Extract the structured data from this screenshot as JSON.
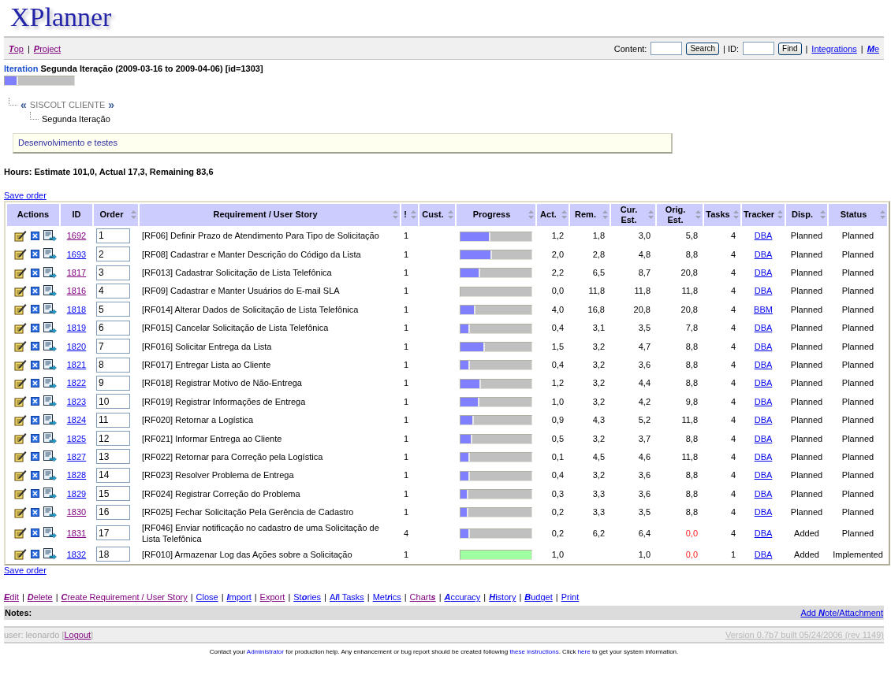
{
  "logo": "XPlanner",
  "nav": {
    "separator": "|",
    "links": [
      {
        "label": "**T**op",
        "visited": true
      },
      {
        "label": "**P**roject",
        "visited": true
      }
    ],
    "content_label": "Content:",
    "search_button": "Search",
    "id_label": "| ID:",
    "find_button": "Find",
    "right_links": [
      {
        "label": "Integrations",
        "visited": false
      },
      {
        "label": "**M**e",
        "visited": false
      }
    ]
  },
  "iteration": {
    "label": "Iteration",
    "title": "Segunda Iteração (2009-03-16 to 2009-04-06) [id=1303]",
    "level": 0.17
  },
  "breadcrumb": {
    "prev": "«",
    "project": "SISCOLT CLIENTE",
    "next": "»",
    "iteration": "Segunda Iteração"
  },
  "description": "Desenvolvimento e testes",
  "hours": "Hours: Estimate 101,0, Actual 17,3, Remaining 83,6",
  "save_order_top": "Save order",
  "table": {
    "columns": [
      {
        "label": "Actions",
        "sortable": false
      },
      {
        "label": "ID",
        "sortable": false
      },
      {
        "label": "Order",
        "sortable": true
      },
      {
        "label": "Requirement / User Story",
        "sortable": true
      },
      {
        "label": "!",
        "sortable": true
      },
      {
        "label": "Cust.",
        "sortable": true
      },
      {
        "label": "Progress",
        "sortable": true
      },
      {
        "label": "Act.",
        "sortable": true
      },
      {
        "label": "Rem.",
        "sortable": true
      },
      {
        "label": "Cur. Est.",
        "sortable": true
      },
      {
        "label": "Orig. Est.",
        "sortable": true
      },
      {
        "label": "Tasks",
        "sortable": true
      },
      {
        "label": "Tracker",
        "sortable": true
      },
      {
        "label": "Disp.",
        "sortable": true
      },
      {
        "label": "Status",
        "sortable": true
      }
    ],
    "rows": [
      {
        "id": "1692",
        "visited": true,
        "order": "1",
        "story": "[RF06] Definir Prazo de Atendimento Para Tipo de Solicitação",
        "priority": "1",
        "level": 0.4,
        "complete": false,
        "act": "1,2",
        "rem": "1,8",
        "cur": "3,0",
        "orig": "5,8",
        "orig_alert": false,
        "tasks": "4",
        "tracker": "DBA",
        "disp": "Planned",
        "status": "Planned"
      },
      {
        "id": "1693",
        "visited": false,
        "order": "2",
        "story": "[RF08] Cadastrar e Manter Descrição do Código da Lista",
        "priority": "1",
        "level": 0.42,
        "complete": false,
        "act": "2,0",
        "rem": "2,8",
        "cur": "4,8",
        "orig": "8,8",
        "orig_alert": false,
        "tasks": "4",
        "tracker": "DBA",
        "disp": "Planned",
        "status": "Planned"
      },
      {
        "id": "1817",
        "visited": true,
        "order": "3",
        "story": "[RF013] Cadastrar Solicitação de Lista Telefônica",
        "priority": "1",
        "level": 0.25,
        "complete": false,
        "act": "2,2",
        "rem": "6,5",
        "cur": "8,7",
        "orig": "20,8",
        "orig_alert": false,
        "tasks": "4",
        "tracker": "DBA",
        "disp": "Planned",
        "status": "Planned"
      },
      {
        "id": "1816",
        "visited": true,
        "order": "4",
        "story": "[RF09] Cadastrar e Manter Usuários do E-mail SLA",
        "priority": "1",
        "level": 0,
        "complete": false,
        "act": "0,0",
        "rem": "11,8",
        "cur": "11,8",
        "orig": "11,8",
        "orig_alert": false,
        "tasks": "4",
        "tracker": "DBA",
        "disp": "Planned",
        "status": "Planned"
      },
      {
        "id": "1818",
        "visited": false,
        "order": "5",
        "story": "[RF014] Alterar Dados de Solicitação de Lista Telefônica",
        "priority": "1",
        "level": 0.19,
        "complete": false,
        "act": "4,0",
        "rem": "16,8",
        "cur": "20,8",
        "orig": "20,8",
        "orig_alert": false,
        "tasks": "4",
        "tracker": "BBM",
        "disp": "Planned",
        "status": "Planned"
      },
      {
        "id": "1819",
        "visited": false,
        "order": "6",
        "story": "[RF015] Cancelar Solicitação de Lista Telefônica",
        "priority": "1",
        "level": 0.11,
        "complete": false,
        "act": "0,4",
        "rem": "3,1",
        "cur": "3,5",
        "orig": "7,8",
        "orig_alert": false,
        "tasks": "4",
        "tracker": "DBA",
        "disp": "Planned",
        "status": "Planned"
      },
      {
        "id": "1820",
        "visited": false,
        "order": "7",
        "story": "[RF016] Solicitar Entrega da Lista",
        "priority": "1",
        "level": 0.32,
        "complete": false,
        "act": "1,5",
        "rem": "3,2",
        "cur": "4,7",
        "orig": "8,8",
        "orig_alert": false,
        "tasks": "4",
        "tracker": "DBA",
        "disp": "Planned",
        "status": "Planned"
      },
      {
        "id": "1821",
        "visited": false,
        "order": "8",
        "story": "[RF017] Entregar Lista ao Cliente",
        "priority": "1",
        "level": 0.11,
        "complete": false,
        "act": "0,4",
        "rem": "3,2",
        "cur": "3,6",
        "orig": "8,8",
        "orig_alert": false,
        "tasks": "4",
        "tracker": "DBA",
        "disp": "Planned",
        "status": "Planned"
      },
      {
        "id": "1822",
        "visited": false,
        "order": "9",
        "story": "[RF018] Registrar Motivo de Não-Entrega",
        "priority": "1",
        "level": 0.27,
        "complete": false,
        "act": "1,2",
        "rem": "3,2",
        "cur": "4,4",
        "orig": "8,8",
        "orig_alert": false,
        "tasks": "4",
        "tracker": "DBA",
        "disp": "Planned",
        "status": "Planned"
      },
      {
        "id": "1823",
        "visited": false,
        "order": "10",
        "story": "[RF019] Registrar Informações de Entrega",
        "priority": "1",
        "level": 0.24,
        "complete": false,
        "act": "1,0",
        "rem": "3,2",
        "cur": "4,2",
        "orig": "9,8",
        "orig_alert": false,
        "tasks": "4",
        "tracker": "DBA",
        "disp": "Planned",
        "status": "Planned"
      },
      {
        "id": "1824",
        "visited": false,
        "order": "11",
        "story": "[RF020] Retornar a Logística",
        "priority": "1",
        "level": 0.17,
        "complete": false,
        "act": "0,9",
        "rem": "4,3",
        "cur": "5,2",
        "orig": "11,8",
        "orig_alert": false,
        "tasks": "4",
        "tracker": "DBA",
        "disp": "Planned",
        "status": "Planned"
      },
      {
        "id": "1825",
        "visited": false,
        "order": "12",
        "story": "[RF021] Informar Entrega ao Cliente",
        "priority": "1",
        "level": 0.14,
        "complete": false,
        "act": "0,5",
        "rem": "3,2",
        "cur": "3,7",
        "orig": "8,8",
        "orig_alert": false,
        "tasks": "4",
        "tracker": "DBA",
        "disp": "Planned",
        "status": "Planned"
      },
      {
        "id": "1827",
        "visited": false,
        "order": "13",
        "story": "[RF022] Retornar para Correção pela Logística",
        "priority": "1",
        "level": 0.11,
        "complete": false,
        "act": "0,1",
        "rem": "4,5",
        "cur": "4,6",
        "orig": "11,8",
        "orig_alert": false,
        "tasks": "4",
        "tracker": "DBA",
        "disp": "Planned",
        "status": "Planned"
      },
      {
        "id": "1828",
        "visited": false,
        "order": "14",
        "story": "[RF023] Resolver Problema de Entrega",
        "priority": "1",
        "level": 0.11,
        "complete": false,
        "act": "0,4",
        "rem": "3,2",
        "cur": "3,6",
        "orig": "8,8",
        "orig_alert": false,
        "tasks": "4",
        "tracker": "DBA",
        "disp": "Planned",
        "status": "Planned"
      },
      {
        "id": "1829",
        "visited": false,
        "order": "15",
        "story": "[RF024] Registrar Correção do Problema",
        "priority": "1",
        "level": 0.09,
        "complete": false,
        "act": "0,3",
        "rem": "3,3",
        "cur": "3,6",
        "orig": "8,8",
        "orig_alert": false,
        "tasks": "4",
        "tracker": "DBA",
        "disp": "Planned",
        "status": "Planned"
      },
      {
        "id": "1830",
        "visited": true,
        "order": "16",
        "story": "[RF025] Fechar Solicitação Pela Gerência de Cadastro",
        "priority": "1",
        "level": 0.09,
        "complete": false,
        "act": "0,2",
        "rem": "3,3",
        "cur": "3,5",
        "orig": "8,8",
        "orig_alert": false,
        "tasks": "4",
        "tracker": "DBA",
        "disp": "Planned",
        "status": "Planned"
      },
      {
        "id": "1831",
        "visited": true,
        "order": "17",
        "story": "[RF046] Enviar notificação no cadastro de uma Solicitação de Lista Telefônica",
        "priority": "4",
        "level": 0.11,
        "complete": false,
        "act": "0,2",
        "rem": "6,2",
        "cur": "6,4",
        "orig": "0,0",
        "orig_alert": true,
        "tasks": "4",
        "tracker": "DBA",
        "disp": "Added",
        "status": "Planned"
      },
      {
        "id": "1832",
        "visited": false,
        "order": "18",
        "story": "[RF010] Armazenar Log das Ações sobre a Solicitação",
        "priority": "1",
        "level": 1,
        "complete": true,
        "act": "1,0",
        "cur": "1,0",
        "orig": "0,0",
        "orig_alert": true,
        "tasks": "1",
        "tracker": "DBA",
        "disp": "Added",
        "status": "Implemented"
      }
    ]
  },
  "save_order_bottom": "Save order",
  "actions": {
    "separator": "|",
    "links": [
      {
        "label": "**E**dit",
        "visited": true
      },
      {
        "label": "**D**elete",
        "visited": true
      },
      {
        "label": "**C**reate Requirement / User Story",
        "visited": true
      },
      {
        "label": "Close",
        "visited": false
      },
      {
        "label": "**I**mport",
        "visited": false
      },
      {
        "label": "Export",
        "visited": true
      },
      {
        "label": "St**o**ries",
        "visited": false
      },
      {
        "label": "A**l**l Tasks",
        "visited": false
      },
      {
        "label": "Met**r**ics",
        "visited": false
      },
      {
        "label": "Chart**s**",
        "visited": true
      },
      {
        "label": "**A**ccuracy",
        "visited": false
      },
      {
        "label": "**H**istory",
        "visited": false
      },
      {
        "label": "**B**udget",
        "visited": false
      },
      {
        "label": "Print",
        "visited": false
      }
    ]
  },
  "notes": {
    "label": "Notes:",
    "add_link": "Add **N**ote/Attachment"
  },
  "footer": {
    "user": "user: leonardo",
    "open": "[",
    "logout": "Logout",
    "close": "]",
    "version": "Version 0.7b7 built 05/24/2006 (rev 1149)"
  },
  "contact": [
    {
      "kind": "text",
      "text": "Contact your "
    },
    {
      "kind": "link",
      "text": "Administrator"
    },
    {
      "kind": "text",
      "text": " for production help. Any enhancement or bug report should be created following "
    },
    {
      "kind": "link",
      "text": "these instructions"
    },
    {
      "kind": "text",
      "text": ". Click "
    },
    {
      "kind": "link",
      "text": "here"
    },
    {
      "kind": "text",
      "text": " to get your system information."
    }
  ]
}
